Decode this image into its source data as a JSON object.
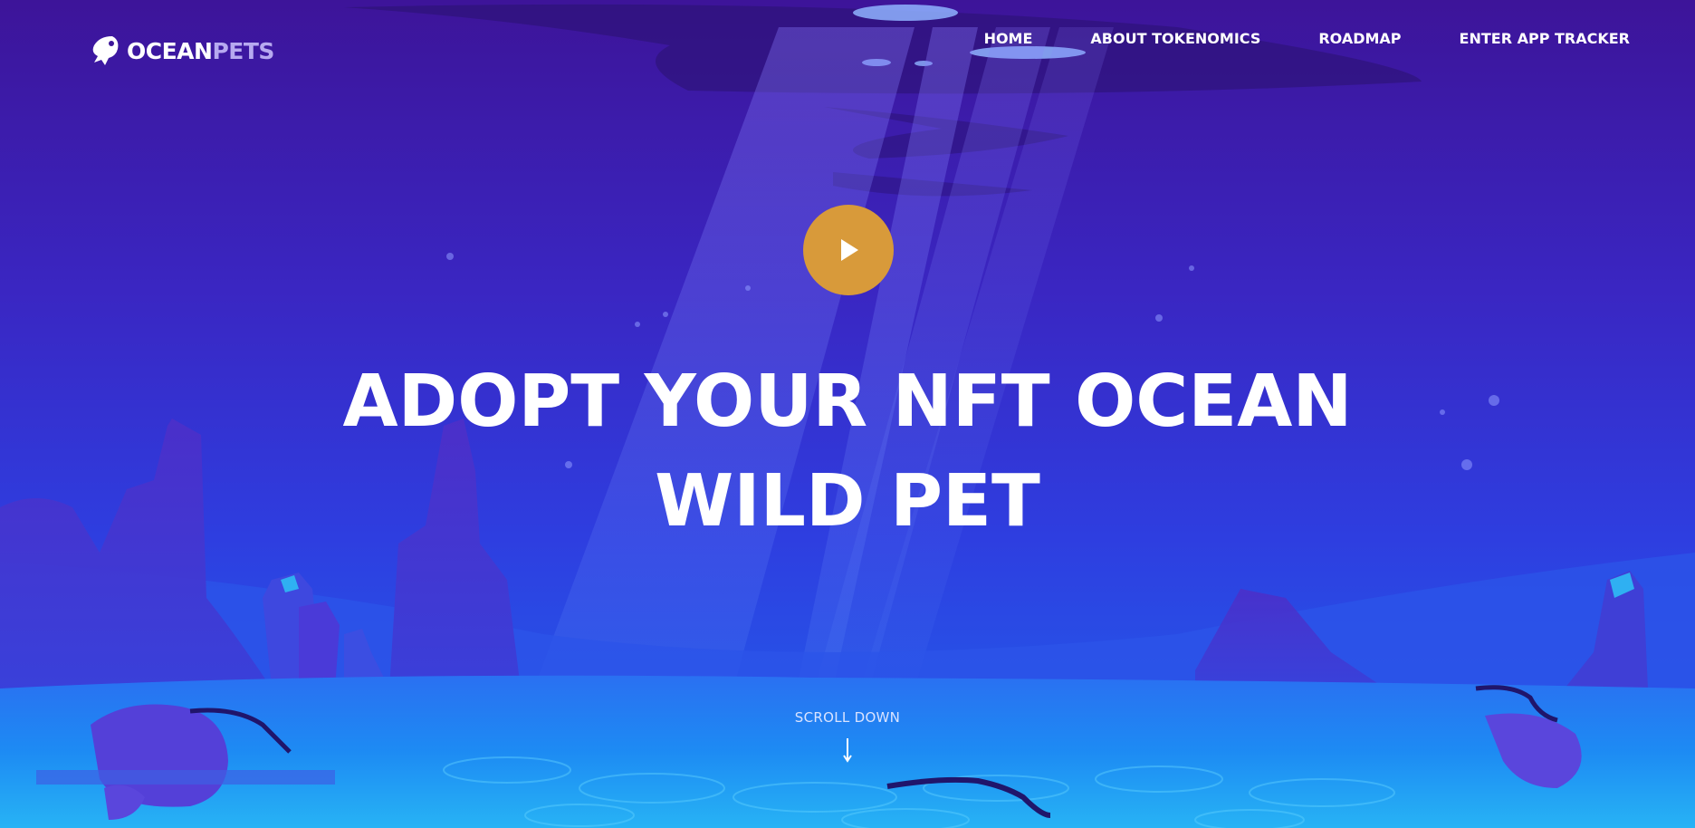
{
  "brand": {
    "name_part1": "OCEAN",
    "name_part2": "PETS",
    "logo_icon": "fish-icon"
  },
  "nav": {
    "items": [
      {
        "label": "HOME"
      },
      {
        "label": "ABOUT TOKENOMICS"
      },
      {
        "label": "ROADMAP"
      },
      {
        "label": "ENTER APP TRACKER"
      }
    ]
  },
  "hero": {
    "title_line1": "ADOPT YOUR NFT OCEAN",
    "title_line2": "WILD PET",
    "play_icon": "play-icon"
  },
  "scroll": {
    "label": "SCROLL DOWN",
    "icon": "arrow-down-icon"
  },
  "colors": {
    "accent_play": "#d89a3a",
    "sky_top": "#3d1699",
    "sea_floor": "#1f7cf0"
  }
}
